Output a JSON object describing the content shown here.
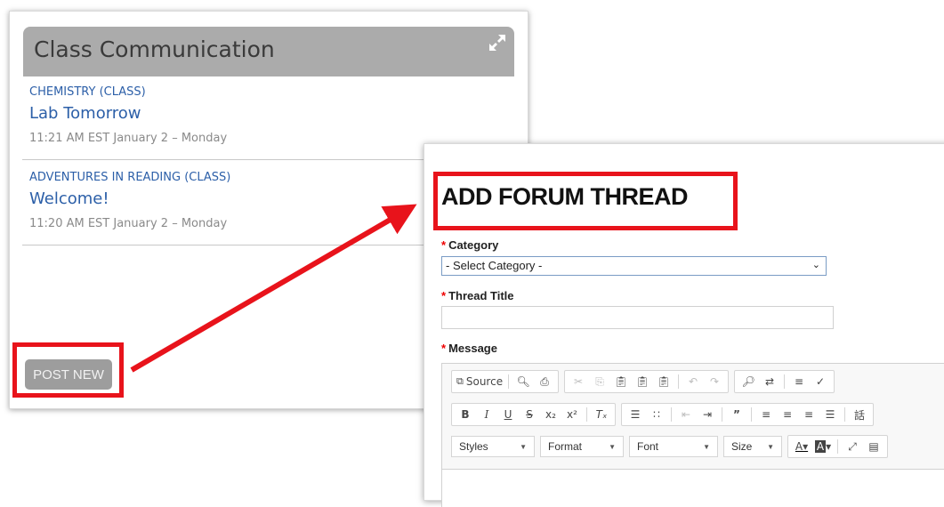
{
  "left_panel": {
    "title": "Class Communication",
    "messages": [
      {
        "class_name": "CHEMISTRY (CLASS)",
        "title": "Lab Tomorrow",
        "time": "11:21 AM EST January 2 – Monday"
      },
      {
        "class_name": "ADVENTURES IN READING (CLASS)",
        "title": "Welcome!",
        "time": "11:20 AM EST January 2 – Monday"
      }
    ],
    "post_new_label": "POST NEW"
  },
  "form": {
    "title": "ADD FORUM THREAD",
    "required_mark": "*",
    "category_label": "Category",
    "category_value": "- Select Category -",
    "thread_title_label": "Thread Title",
    "thread_title_value": "",
    "message_label": "Message"
  },
  "editor": {
    "source_label": "Source",
    "styles_label": "Styles",
    "format_label": "Format",
    "font_label": "Font",
    "size_label": "Size"
  },
  "colors": {
    "highlight": "#e8131b",
    "link": "#2c5fa8",
    "header_bg": "#ababab"
  }
}
